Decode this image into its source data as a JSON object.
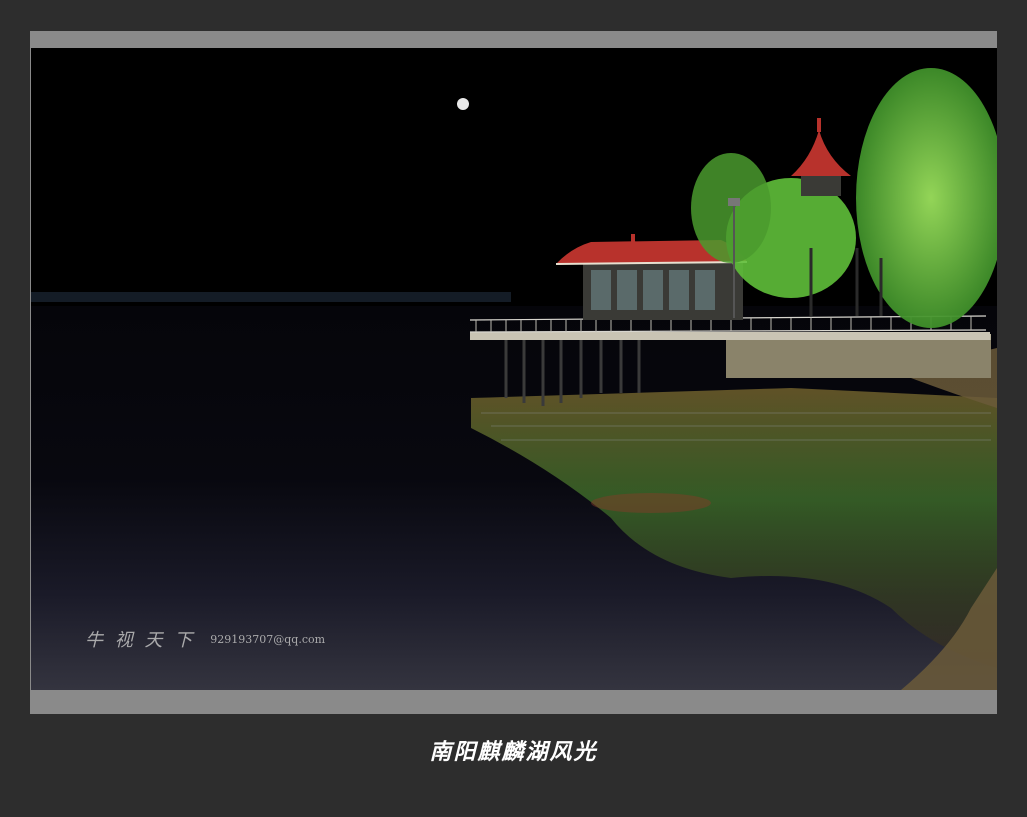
{
  "photo": {
    "caption": "南阳麒麟湖风光",
    "watermark": {
      "brush_text": "牛 视 天 下",
      "email": "929193707@qq.com"
    }
  },
  "colors": {
    "frame": "#2d2d2d",
    "mat": "#8a8a8a",
    "roof_red": "#b8322c",
    "foliage_green": "#5fbf3a",
    "water_dark": "#0b0b14"
  }
}
